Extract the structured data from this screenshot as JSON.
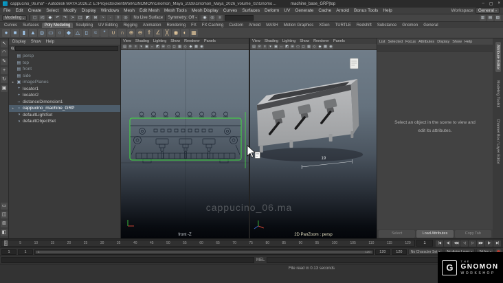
{
  "window": {
    "title": "cappucino_06.ma* - Autodesk MAYA 2026.2: E:\\Projects\\clientWork\\GNOMON\\Gnomon_Maya_2026\\Gnomon_Maya_2026_volume_02\\Gnomon_Maya_2026_v02_Project\\scenes\\cappucino_06.ma",
    "context": "machine_base_GRP|top",
    "controls": [
      {
        "name": "minimize-button",
        "glyph": "–"
      },
      {
        "name": "maximize-button",
        "glyph": "▢"
      },
      {
        "name": "close-button",
        "glyph": "×"
      }
    ]
  },
  "menu_bar": {
    "items": [
      "File",
      "Edit",
      "Create",
      "Select",
      "Modify",
      "Display",
      "Windows",
      "Mesh",
      "Edit Mesh",
      "Mesh Tools",
      "Mesh Display",
      "Curves",
      "Surfaces",
      "Deform",
      "UV",
      "Generate",
      "Cache",
      "Arnold",
      "Bonus Tools",
      "Help"
    ],
    "workspace_label": "Workspace",
    "workspace_value": "General"
  },
  "status_line": {
    "mode": "Modeling",
    "icons": [
      {
        "name": "new-scene-icon",
        "glyph": "▢"
      },
      {
        "name": "open-scene-icon",
        "glyph": "◰"
      },
      {
        "name": "save-scene-icon",
        "glyph": "◆"
      },
      {
        "name": "undo-icon",
        "glyph": "↶"
      },
      {
        "name": "redo-icon",
        "glyph": "↷"
      },
      {
        "name": "select-by-hierarchy-icon",
        "glyph": "≻"
      },
      {
        "name": "select-by-object-icon",
        "glyph": "◫"
      },
      {
        "name": "select-by-component-icon",
        "glyph": "◩"
      },
      {
        "name": "snap-to-grid-icon",
        "glyph": "⊞"
      },
      {
        "name": "snap-to-curve-icon",
        "glyph": "~"
      },
      {
        "name": "snap-to-point-icon",
        "glyph": "∙"
      },
      {
        "name": "snap-to-plane-icon",
        "glyph": "◊"
      },
      {
        "name": "make-live-icon",
        "glyph": "◎"
      }
    ],
    "no_live_surface": "No Live Surface",
    "symmetry": "Symmetry: Off",
    "render_icons": [
      {
        "name": "render-current-frame-icon",
        "glyph": "◉"
      },
      {
        "name": "ipr-render-icon",
        "glyph": "◎"
      },
      {
        "name": "render-settings-icon",
        "glyph": "≡"
      }
    ],
    "field_value": "",
    "dock_toggles": [
      {
        "name": "attribute-editor-toggle-icon",
        "glyph": "▥"
      },
      {
        "name": "tool-settings-toggle-icon",
        "glyph": "▤"
      },
      {
        "name": "channel-box-toggle-icon",
        "glyph": "▧"
      }
    ]
  },
  "shelf": {
    "tabs": [
      {
        "label": "Curves"
      },
      {
        "label": "Surfaces"
      },
      {
        "label": "Poly Modeling",
        "cls": "active"
      },
      {
        "label": "Sculpting"
      },
      {
        "label": "UV Editing"
      },
      {
        "label": "Rigging"
      },
      {
        "label": "Animation"
      },
      {
        "label": "Rendering"
      },
      {
        "label": "FX"
      },
      {
        "label": "FX Caching"
      },
      {
        "label": "Custom"
      },
      {
        "label": "Arnold"
      },
      {
        "label": "MASH"
      },
      {
        "label": "Motion Graphics"
      },
      {
        "label": "XGen"
      },
      {
        "label": "TURTLE"
      },
      {
        "label": "Redshift"
      },
      {
        "label": "Substance"
      },
      {
        "label": "Gnomon"
      },
      {
        "label": "General"
      }
    ],
    "icons": [
      {
        "name": "poly-sphere-icon",
        "glyph": "●",
        "cls": "prim"
      },
      {
        "name": "poly-cube-icon",
        "glyph": "■",
        "cls": "prim"
      },
      {
        "name": "poly-cylinder-icon",
        "glyph": "▮",
        "cls": "prim"
      },
      {
        "name": "poly-cone-icon",
        "glyph": "▲",
        "cls": "prim"
      },
      {
        "name": "poly-torus-icon",
        "glyph": "◎",
        "cls": "prim"
      },
      {
        "name": "poly-plane-icon",
        "glyph": "▭",
        "cls": "prim"
      },
      {
        "name": "poly-disc-icon",
        "glyph": "○",
        "cls": "prim"
      },
      {
        "name": "poly-platonic-icon",
        "glyph": "◆",
        "cls": "prim"
      },
      {
        "name": "poly-pyramid-icon",
        "glyph": "△",
        "cls": "prim"
      },
      {
        "name": "poly-pipe-icon",
        "glyph": "▯",
        "cls": "prim"
      },
      {
        "name": "poly-helix-icon",
        "glyph": "≈",
        "cls": "prim"
      },
      {
        "name": "poly-gear-icon",
        "glyph": "*",
        "cls": "prim"
      },
      {
        "name": "boolean-union-icon",
        "glyph": "∪",
        "cls": "tool"
      },
      {
        "name": "boolean-difference-icon",
        "glyph": "∩",
        "cls": "tool"
      },
      {
        "name": "combine-icon",
        "glyph": "⊕",
        "cls": "tool"
      },
      {
        "name": "separate-icon",
        "glyph": "⊖",
        "cls": "tool"
      },
      {
        "name": "extrude-icon",
        "glyph": "⇑",
        "cls": "tool"
      },
      {
        "name": "bevel-icon",
        "glyph": "∠",
        "cls": "tool"
      },
      {
        "name": "multi-cut-icon",
        "glyph": "╳",
        "cls": "tool"
      },
      {
        "name": "target-weld-icon",
        "glyph": "◉",
        "cls": "tool"
      },
      {
        "name": "mirror-icon",
        "glyph": "◐",
        "cls": "tool"
      },
      {
        "name": "quad-draw-icon",
        "glyph": "▦",
        "cls": "tool"
      }
    ]
  },
  "toolbox": {
    "tools": [
      {
        "name": "select-tool-icon",
        "glyph": "↖"
      },
      {
        "name": "lasso-select-tool-icon",
        "glyph": "◠"
      },
      {
        "name": "paint-select-tool-icon",
        "glyph": "✎"
      },
      {
        "name": "move-tool-icon",
        "glyph": "+"
      },
      {
        "name": "rotate-tool-icon",
        "glyph": "↻"
      },
      {
        "name": "scale-tool-icon",
        "glyph": "▣"
      }
    ],
    "layouts": [
      {
        "name": "single-pane-layout-icon",
        "glyph": "▭"
      },
      {
        "name": "two-pane-layout-icon",
        "glyph": "◫"
      },
      {
        "name": "four-pane-layout-icon",
        "glyph": "⊞"
      },
      {
        "name": "outliner-persp-layout-icon",
        "glyph": "◧"
      }
    ]
  },
  "outliner": {
    "menus": [
      "Display",
      "Show",
      "Help"
    ],
    "search_value": "",
    "items": [
      {
        "arrow": "",
        "icon": "▤",
        "label": "persp",
        "cls": "dim"
      },
      {
        "arrow": "",
        "icon": "▤",
        "label": "top",
        "cls": "dim"
      },
      {
        "arrow": "",
        "icon": "▤",
        "label": "front",
        "cls": "dim"
      },
      {
        "arrow": "",
        "icon": "▤",
        "label": "side",
        "cls": "dim"
      },
      {
        "arrow": "▸",
        "icon": "▣",
        "label": "imagePlanes",
        "cls": "dim"
      },
      {
        "arrow": "",
        "icon": "+",
        "label": "locator1"
      },
      {
        "arrow": "",
        "icon": "+",
        "label": "locator2"
      },
      {
        "arrow": "",
        "icon": "↔",
        "label": "distanceDimension1"
      },
      {
        "arrow": "▸",
        "icon": "○",
        "label": "cappucino_machine_GRP",
        "cls": "sel"
      },
      {
        "arrow": "",
        "icon": "◑",
        "label": "defaultLightSet"
      },
      {
        "arrow": "",
        "icon": "◑",
        "label": "defaultObjectSet"
      }
    ]
  },
  "viewports": {
    "panel_menus": [
      "View",
      "Shading",
      "Lighting",
      "Show",
      "Renderer",
      "Panels"
    ],
    "toolbar_icons": [
      {
        "name": "select-camera-icon",
        "glyph": "▤"
      },
      {
        "name": "lock-camera-icon",
        "glyph": "⊘"
      },
      {
        "name": "camera-attributes-icon",
        "glyph": "≡"
      },
      {
        "name": "bookmarks-icon",
        "glyph": "▾"
      },
      {
        "name": "image-plane-icon",
        "glyph": "▣"
      },
      {
        "name": "two-d-pan-zoom-icon",
        "glyph": "⇔"
      },
      {
        "name": "isolate-select-icon",
        "glyph": "◩"
      },
      {
        "name": "grid-icon",
        "glyph": "⊞"
      },
      {
        "name": "film-gate-icon",
        "glyph": "▭"
      },
      {
        "name": "resolution-gate-icon",
        "glyph": "◻"
      },
      {
        "name": "gate-mask-icon",
        "glyph": "▦"
      },
      {
        "name": "wireframe-display-icon",
        "glyph": "◇"
      },
      {
        "name": "shaded-display-icon",
        "glyph": "◆"
      },
      {
        "name": "textured-display-icon",
        "glyph": "▩"
      },
      {
        "name": "lighting-icon",
        "glyph": "◉"
      }
    ],
    "left": {
      "label": "front -Z"
    },
    "right": {
      "label": "2D PanZoom : persp",
      "dimension_label": "19"
    },
    "watermark": "cappucino_06.ma"
  },
  "attribute_editor": {
    "menus": [
      "List",
      "Selected",
      "Focus",
      "Attributes",
      "Display",
      "Show",
      "Help"
    ],
    "message": "Select an object in the scene to view and edit its attributes.",
    "buttons": [
      {
        "label": "Select",
        "cls": "dim"
      },
      {
        "label": "Load Attributes"
      },
      {
        "label": "Copy Tab",
        "cls": "dim"
      }
    ]
  },
  "right_sidebar": {
    "tabs": [
      {
        "label": "Attribute Editor",
        "cls": "active"
      },
      {
        "label": "Modeling Toolkit"
      },
      {
        "label": "Channel Box / Layer Editor"
      }
    ]
  },
  "timeline": {
    "current_frame": "1",
    "ticks": [
      "1",
      "5",
      "10",
      "15",
      "20",
      "25",
      "30",
      "35",
      "40",
      "45",
      "50",
      "55",
      "60",
      "65",
      "70",
      "75",
      "80",
      "85",
      "90",
      "95",
      "100",
      "105",
      "110",
      "115",
      "120"
    ],
    "playback_controls": [
      {
        "name": "go-to-start-button",
        "glyph": "|◀"
      },
      {
        "name": "step-back-frame-button",
        "glyph": "◀|"
      },
      {
        "name": "step-back-key-button",
        "glyph": "◀◀"
      },
      {
        "name": "play-backwards-button",
        "glyph": "◁"
      },
      {
        "name": "play-forwards-button",
        "glyph": "▷"
      },
      {
        "name": "step-forward-key-button",
        "glyph": "▶▶"
      },
      {
        "name": "step-forward-frame-button",
        "glyph": "|▶"
      },
      {
        "name": "go-to-end-button",
        "glyph": "▶|"
      }
    ]
  },
  "range_slider": {
    "anim_start": "1",
    "playback_start": "1",
    "bar_start": "1",
    "bar_end": "120",
    "playback_end": "120",
    "anim_end": "120",
    "character_set": "No Character Set",
    "anim_layer": "No Anim Layer",
    "fps": "24 fps"
  },
  "command_line": {
    "language": "MEL",
    "input": "",
    "output": ""
  },
  "help_line": {
    "text": "File read in 0.13 seconds"
  },
  "logo": {
    "the": "THE",
    "gnomon": "GNOMON",
    "workshop": "WORKSHOP",
    "mark": "G"
  }
}
